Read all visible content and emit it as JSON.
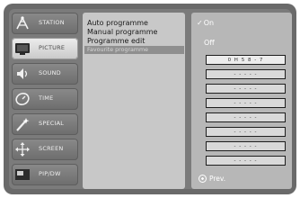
{
  "categories": [
    {
      "id": "station",
      "label": "STATION",
      "icon": "antenna-icon",
      "active": false
    },
    {
      "id": "picture",
      "label": "PICTURE",
      "icon": "tv-icon",
      "active": true
    },
    {
      "id": "sound",
      "label": "SOUND",
      "icon": "speaker-icon",
      "active": false
    },
    {
      "id": "time",
      "label": "TIME",
      "icon": "clock-icon",
      "active": false
    },
    {
      "id": "special",
      "label": "SPECIAL",
      "icon": "magic-wand-icon",
      "active": false
    },
    {
      "id": "screen",
      "label": "SCREEN",
      "icon": "arrows-icon",
      "active": false
    },
    {
      "id": "pip",
      "label": "PIP/DW",
      "icon": "pip-icon",
      "active": false
    }
  ],
  "submenu": {
    "items": [
      {
        "label": "Auto programme"
      },
      {
        "label": "Manual programme"
      },
      {
        "label": "Programme edit"
      },
      {
        "label": "Favourite programme",
        "highlighted": true
      }
    ]
  },
  "options": {
    "on_label": "On",
    "on_checked": true,
    "off_label": "Off",
    "slots": [
      "0  H  5  8  -  7",
      "- - - - -",
      "- - - - -",
      "- - - - -",
      "- - - - -",
      "- - - - -",
      "- - - - -",
      "- - - - -"
    ],
    "prev_label": "Prev."
  }
}
